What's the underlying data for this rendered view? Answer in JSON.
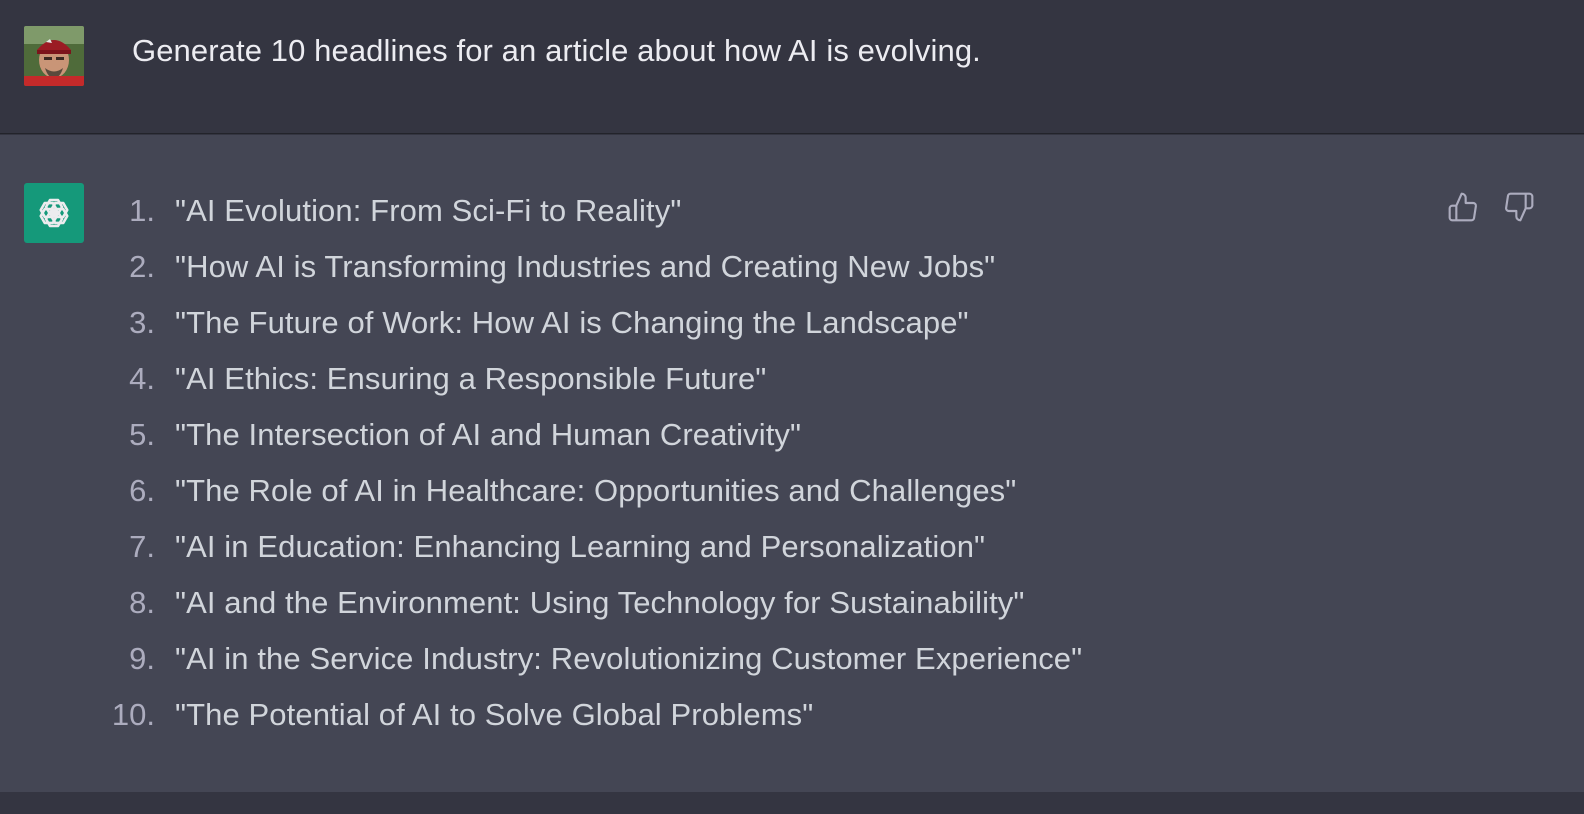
{
  "user": {
    "avatar": "user-photo-avatar",
    "prompt": "Generate 10 headlines for an article about how AI is evolving."
  },
  "assistant": {
    "avatar": "openai-logo-icon",
    "accent_color": "#10a37f",
    "headlines": [
      {
        "num": "1.",
        "text": "\"AI Evolution: From Sci-Fi to Reality\""
      },
      {
        "num": "2.",
        "text": "\"How AI is Transforming Industries and Creating New Jobs\""
      },
      {
        "num": "3.",
        "text": "\"The Future of Work: How AI is Changing the Landscape\""
      },
      {
        "num": "4.",
        "text": "\"AI Ethics: Ensuring a Responsible Future\""
      },
      {
        "num": "5.",
        "text": "\"The Intersection of AI and Human Creativity\""
      },
      {
        "num": "6.",
        "text": "\"The Role of AI in Healthcare: Opportunities and Challenges\""
      },
      {
        "num": "7.",
        "text": "\"AI in Education: Enhancing Learning and Personalization\""
      },
      {
        "num": "8.",
        "text": "\"AI and the Environment: Using Technology for Sustainability\""
      },
      {
        "num": "9.",
        "text": "\"AI in the Service Industry: Revolutionizing Customer Experience\""
      },
      {
        "num": "10.",
        "text": "\"The Potential of AI to Solve Global Problems\""
      }
    ],
    "feedback": {
      "thumbs_up_icon": "thumbs-up-icon",
      "thumbs_down_icon": "thumbs-down-icon"
    }
  },
  "colors": {
    "user_bg": "#343541",
    "assistant_bg": "#444654",
    "text": "#d1d5db",
    "muted": "#acacbe"
  }
}
